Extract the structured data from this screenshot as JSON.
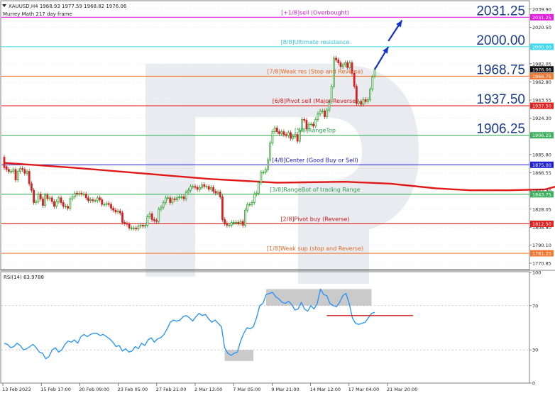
{
  "chart_data": [
    {
      "type": "candlestick",
      "header": {
        "symbol_line": "XAUUSD,H4  1968.93 1977.59 1968.82 1976.06",
        "indicator_line": "Murrey Math 217 day frame"
      },
      "symbol": "XAUUSD",
      "timeframe": "H4",
      "ohlc": {
        "open": 1968.93,
        "high": 1977.59,
        "low": 1968.82,
        "close": 1976.06
      },
      "ylim": [
        1764,
        2048
      ],
      "price_ticks": [
        "2039.90",
        "2020.50",
        "1982.05",
        "1962.80",
        "1943.55",
        "1924.30",
        "1885.80",
        "1866.55",
        "1847.30",
        "1828.05",
        "1808.80",
        "1790.10",
        "1770.85"
      ],
      "current_price": "1976.06",
      "x_ticks": [
        "13 Feb 2023",
        "15 Feb 17:00",
        "20 Feb 09:00",
        "23 Feb 05:00",
        "27 Feb 21:00",
        "2 Mar 13:00",
        "7 Mar 05:00",
        "9 Mar 21:00",
        "14 Mar 12:00",
        "17 Mar 04:00",
        "21 Mar 20:00"
      ],
      "murrey_levels": [
        {
          "price": 2031.25,
          "label": "[+1/8]sell (Overbought)",
          "tag": "2031.25",
          "color": "#e020e0",
          "label_color": "#d020d0"
        },
        {
          "price": 2000.0,
          "label": "[8/8]Ultimate resistance",
          "tag": "2000.00",
          "color": "#40d8f0",
          "label_color": "#30c8e8"
        },
        {
          "price": 1968.75,
          "label": "[7/8]Weak res (Stop and Reverse)",
          "tag": "1968.75",
          "color": "#f07830",
          "label_color": "#e06820"
        },
        {
          "price": 1937.5,
          "label": "[6/8]Pivot sell (Major Reverse)",
          "tag": "1937.50",
          "color": "#e02020",
          "label_color": "#d01818"
        },
        {
          "price": 1906.25,
          "label": "[5/8]RangeTop",
          "tag": "1906.25",
          "color": "#40b060",
          "label_color": "#30a050"
        },
        {
          "price": 1875.0,
          "label": "[4/8]Center (Good Buy or Sell)",
          "tag": "1875.00",
          "color": "#2020d0",
          "label_color": "#1818c0"
        },
        {
          "price": 1843.75,
          "label": "[3/8]RangeBot of trading Range",
          "tag": "1843.75",
          "color": "#40b060",
          "label_color": "#30a050"
        },
        {
          "price": 1812.5,
          "label": "[2/8]Pivot buy (Reverse)",
          "tag": "1812.50",
          "color": "#e02020",
          "label_color": "#d01818"
        },
        {
          "price": 1781.25,
          "label": "[1/8]Weak sup (stop and Reverse)",
          "tag": "1781.25",
          "color": "#f07830",
          "label_color": "#e06820"
        }
      ],
      "big_labels": [
        "2031.25",
        "2000.00",
        "1968.75",
        "1937.50",
        "1906.25"
      ],
      "big_label_color": "#1a3a8a",
      "candles": [
        [
          1883.0,
          1872.0
        ],
        [
          1873.0,
          1870.0
        ],
        [
          1870.0,
          1868.0
        ],
        [
          1868.0,
          1868.0
        ],
        [
          1868.0,
          1870.0
        ],
        [
          1870.0,
          1859.0
        ],
        [
          1859.0,
          1868.0
        ],
        [
          1868.0,
          1871.0
        ],
        [
          1871.0,
          1870.0
        ],
        [
          1870.0,
          1866.0
        ],
        [
          1866.0,
          1868.0
        ],
        [
          1868.0,
          1855.0
        ],
        [
          1855.0,
          1848.0
        ],
        [
          1848.0,
          1835.0
        ],
        [
          1835.0,
          1836.0
        ],
        [
          1836.0,
          1844.0
        ],
        [
          1844.0,
          1839.0
        ],
        [
          1839.0,
          1832.0
        ],
        [
          1832.0,
          1843.0
        ],
        [
          1843.0,
          1839.0
        ],
        [
          1839.0,
          1840.0
        ],
        [
          1840.0,
          1836.0
        ],
        [
          1836.0,
          1831.0
        ],
        [
          1831.0,
          1836.0
        ],
        [
          1836.0,
          1840.0
        ],
        [
          1840.0,
          1835.0
        ],
        [
          1835.0,
          1831.0
        ],
        [
          1831.0,
          1831.0
        ],
        [
          1831.0,
          1829.0
        ],
        [
          1829.0,
          1839.0
        ],
        [
          1839.0,
          1841.0
        ],
        [
          1841.0,
          1845.0
        ],
        [
          1845.0,
          1844.0
        ],
        [
          1844.0,
          1845.0
        ],
        [
          1845.0,
          1844.0
        ],
        [
          1844.0,
          1844.0
        ],
        [
          1844.0,
          1840.0
        ],
        [
          1840.0,
          1837.0
        ],
        [
          1837.0,
          1838.0
        ],
        [
          1838.0,
          1837.0
        ],
        [
          1837.0,
          1837.0
        ],
        [
          1837.0,
          1840.0
        ],
        [
          1840.0,
          1838.0
        ],
        [
          1838.0,
          1833.0
        ],
        [
          1833.0,
          1833.0
        ],
        [
          1833.0,
          1834.0
        ],
        [
          1834.0,
          1833.0
        ],
        [
          1833.0,
          1829.0
        ],
        [
          1829.0,
          1827.0
        ],
        [
          1827.0,
          1825.0
        ],
        [
          1825.0,
          1826.0
        ],
        [
          1826.0,
          1824.0
        ],
        [
          1824.0,
          1814.0
        ],
        [
          1814.0,
          1813.0
        ],
        [
          1813.0,
          1812.0
        ],
        [
          1812.0,
          1808.0
        ],
        [
          1808.0,
          1808.0
        ],
        [
          1808.0,
          1808.0
        ],
        [
          1808.0,
          1807.0
        ],
        [
          1807.0,
          1810.0
        ],
        [
          1810.0,
          1811.0
        ],
        [
          1811.0,
          1810.0
        ],
        [
          1810.0,
          1811.0
        ],
        [
          1811.0,
          1820.0
        ],
        [
          1820.0,
          1823.0
        ],
        [
          1823.0,
          1817.0
        ],
        [
          1817.0,
          1816.0
        ],
        [
          1816.0,
          1815.0
        ],
        [
          1815.0,
          1828.0
        ],
        [
          1828.0,
          1830.0
        ],
        [
          1830.0,
          1835.0
        ],
        [
          1835.0,
          1840.0
        ],
        [
          1840.0,
          1840.0
        ],
        [
          1840.0,
          1835.0
        ],
        [
          1835.0,
          1839.0
        ],
        [
          1839.0,
          1838.0
        ],
        [
          1838.0,
          1840.0
        ],
        [
          1840.0,
          1841.0
        ],
        [
          1841.0,
          1841.0
        ],
        [
          1841.0,
          1839.0
        ],
        [
          1839.0,
          1846.0
        ],
        [
          1846.0,
          1848.0
        ],
        [
          1848.0,
          1852.0
        ],
        [
          1852.0,
          1852.0
        ],
        [
          1852.0,
          1851.0
        ],
        [
          1851.0,
          1849.0
        ],
        [
          1849.0,
          1851.0
        ],
        [
          1851.0,
          1854.0
        ],
        [
          1854.0,
          1852.0
        ],
        [
          1852.0,
          1852.0
        ],
        [
          1852.0,
          1849.0
        ],
        [
          1849.0,
          1851.0
        ],
        [
          1851.0,
          1847.0
        ],
        [
          1847.0,
          1845.0
        ],
        [
          1845.0,
          1846.0
        ],
        [
          1846.0,
          1841.0
        ],
        [
          1841.0,
          1817.0
        ],
        [
          1817.0,
          1813.0
        ],
        [
          1813.0,
          1811.0
        ],
        [
          1811.0,
          1811.0
        ],
        [
          1811.0,
          1814.0
        ],
        [
          1814.0,
          1814.0
        ],
        [
          1814.0,
          1814.0
        ],
        [
          1814.0,
          1813.0
        ],
        [
          1813.0,
          1815.0
        ],
        [
          1815.0,
          1811.0
        ],
        [
          1811.0,
          1827.0
        ],
        [
          1827.0,
          1833.0
        ],
        [
          1833.0,
          1833.0
        ],
        [
          1833.0,
          1835.0
        ],
        [
          1835.0,
          1844.0
        ],
        [
          1844.0,
          1845.0
        ],
        [
          1845.0,
          1856.0
        ],
        [
          1856.0,
          1867.0
        ],
        [
          1867.0,
          1867.0
        ],
        [
          1867.0,
          1870.0
        ],
        [
          1870.0,
          1880.0
        ],
        [
          1880.0,
          1898.0
        ],
        [
          1898.0,
          1910.0
        ],
        [
          1910.0,
          1914.0
        ],
        [
          1914.0,
          1910.0
        ],
        [
          1910.0,
          1908.0
        ],
        [
          1908.0,
          1910.0
        ],
        [
          1910.0,
          1907.0
        ],
        [
          1907.0,
          1906.0
        ],
        [
          1906.0,
          1909.0
        ],
        [
          1909.0,
          1903.0
        ],
        [
          1903.0,
          1905.0
        ],
        [
          1905.0,
          1907.0
        ],
        [
          1907.0,
          1900.0
        ],
        [
          1900.0,
          1912.0
        ],
        [
          1912.0,
          1923.0
        ],
        [
          1923.0,
          1922.0
        ],
        [
          1922.0,
          1913.0
        ],
        [
          1913.0,
          1918.0
        ],
        [
          1918.0,
          1918.0
        ],
        [
          1918.0,
          1916.0
        ],
        [
          1916.0,
          1923.0
        ],
        [
          1923.0,
          1929.0
        ],
        [
          1929.0,
          1932.0
        ],
        [
          1932.0,
          1932.0
        ],
        [
          1932.0,
          1926.0
        ],
        [
          1926.0,
          1933.0
        ],
        [
          1933.0,
          1942.0
        ],
        [
          1942.0,
          1958.0
        ],
        [
          1958.0,
          1988.0
        ],
        [
          1988.0,
          1986.0
        ],
        [
          1986.0,
          1983.0
        ],
        [
          1983.0,
          1979.0
        ],
        [
          1979.0,
          1981.0
        ],
        [
          1981.0,
          1983.0
        ],
        [
          1983.0,
          1978.0
        ],
        [
          1978.0,
          1983.0
        ],
        [
          1983.0,
          1972.0
        ],
        [
          1972.0,
          1958.0
        ],
        [
          1958.0,
          1940.0
        ],
        [
          1940.0,
          1942.0
        ],
        [
          1942.0,
          1939.0
        ],
        [
          1939.0,
          1944.0
        ],
        [
          1944.0,
          1942.0
        ],
        [
          1942.0,
          1944.0
        ],
        [
          1944.0,
          1955.0
        ],
        [
          1955.0,
          1968.0
        ],
        [
          1969.0,
          1976.0
        ]
      ],
      "ma_line": [
        [
          0,
          1877
        ],
        [
          30,
          1872
        ],
        [
          60,
          1866
        ],
        [
          90,
          1860
        ],
        [
          120,
          1856
        ],
        [
          150,
          1857
        ],
        [
          170,
          1855
        ],
        [
          190,
          1850
        ],
        [
          205,
          1848
        ],
        [
          222,
          1848
        ],
        [
          238,
          1849
        ],
        [
          252,
          1858
        ],
        [
          270,
          1866
        ],
        [
          288,
          1874
        ]
      ],
      "forecast_arrow": [
        [
          0,
          1976
        ],
        [
          6,
          2000
        ],
        [
          12,
          2028
        ]
      ]
    },
    {
      "type": "line",
      "title": "RSI(14) 63.9788",
      "name": "RSI(14)",
      "ylim": [
        0,
        100
      ],
      "ticks": [
        "100",
        "70",
        "30",
        "0"
      ],
      "levels": [
        70,
        30
      ],
      "values": [
        36.0,
        35.0,
        32.0,
        33.0,
        36.0,
        34.0,
        30.0,
        31.0,
        33.0,
        35.0,
        32.0,
        28.0,
        27.0,
        22.0,
        24.0,
        30.0,
        32.0,
        28.0,
        30.0,
        35.0,
        38.0,
        37.0,
        39.0,
        36.0,
        42.0,
        44.0,
        42.0,
        44.0,
        45.0,
        45.0,
        43.0,
        44.0,
        42.0,
        40.0,
        37.0,
        33.0,
        34.0,
        29.0,
        31.0,
        28.0,
        29.0,
        33.0,
        31.0,
        36.0,
        34.0,
        39.0,
        41.0,
        37.0,
        40.0,
        41.0,
        44.0,
        49.0,
        55.0,
        57.0,
        56.0,
        57.0,
        60.0,
        61.0,
        59.0,
        56.0,
        60.0,
        63.0,
        61.0,
        62.0,
        58.0,
        55.0,
        57.0,
        54.0,
        51.0,
        32.0,
        27.0,
        25.0,
        27.0,
        28.0,
        38.0,
        45.0,
        50.0,
        49.0,
        51.0,
        59.0,
        70.0,
        72.0,
        80.0,
        81.0,
        82.0,
        78.0,
        76.0,
        73.0,
        72.0,
        74.0,
        71.0,
        66.0,
        67.0,
        73.0,
        67.0,
        65.0,
        70.0,
        67.0,
        72.0,
        85.0,
        80.0,
        79.0,
        72.0,
        70.0,
        69.0,
        73.0,
        79.0,
        81.0,
        72.0,
        59.0,
        54.0,
        53.0,
        54.0,
        55.0,
        59.0,
        63.0,
        64.0
      ],
      "highlights": [
        {
          "from": 69.0,
          "to": 78.0,
          "y_low": 20,
          "y_high": 30
        },
        {
          "from": 82.0,
          "to": 115.0,
          "y_low": 70,
          "y_high": 85
        }
      ],
      "resistance_line": {
        "from": 101.0,
        "to": 128.0,
        "value": 61
      },
      "color": "#1e90ff"
    }
  ]
}
